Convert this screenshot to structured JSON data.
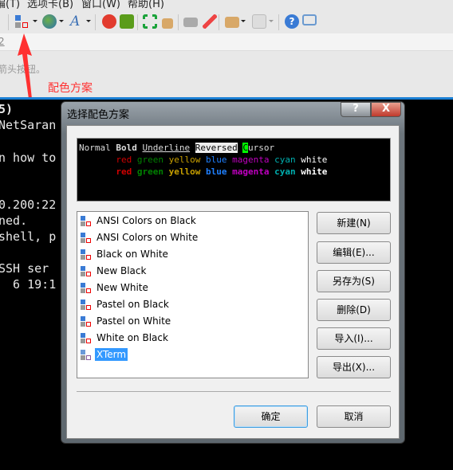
{
  "menubar": {
    "items": [
      "编(T)",
      "选项卡(B)",
      "窗口(W)",
      "帮助(H)"
    ]
  },
  "toolbar": {
    "icons": [
      "color-scheme-icon",
      "globe-icon",
      "font-icon",
      "xftp-icon",
      "xmanager-icon",
      "fullscreen-icon",
      "lock-icon",
      "keyboard-icon",
      "highlighter-icon",
      "new-folder-icon",
      "layout-icon",
      "help-icon",
      "chat-icon"
    ]
  },
  "address": {
    "text": "2"
  },
  "hint": {
    "text": "箭头按钮。"
  },
  "annotation": {
    "text": "配色方案",
    "color": "#ff3030"
  },
  "terminal": {
    "lines": [
      "5)",
      "NetSaran",
      "",
      "n how to",
      "",
      "",
      "0.200:22",
      "ned.",
      "shell, p",
      "",
      "SSH ser",
      "  6 19:1"
    ]
  },
  "dialog": {
    "title": "选择配色方案",
    "help_label": "?",
    "close_label": "X",
    "preview": {
      "row1": {
        "normal": "Normal",
        "bold": "Bold",
        "underline": "Underline",
        "reversed": "Reversed",
        "cursor_char": "C",
        "cursor_rest": "ursor"
      },
      "colors": [
        {
          "name": "red",
          "color": "#d00000"
        },
        {
          "name": "green",
          "color": "#008000"
        },
        {
          "name": "yellow",
          "color": "#c8a000"
        },
        {
          "name": "blue",
          "color": "#2080ff"
        },
        {
          "name": "magenta",
          "color": "#c000c0"
        },
        {
          "name": "cyan",
          "color": "#00b0b0"
        },
        {
          "name": "white",
          "color": "#ffffff"
        }
      ]
    },
    "schemes": [
      "ANSI Colors on Black",
      "ANSI Colors on White",
      "Black on White",
      "New Black",
      "New White",
      "Pastel on Black",
      "Pastel on White",
      "White on Black",
      "XTerm"
    ],
    "selected": "XTerm",
    "buttons": {
      "new": "新建(N)",
      "edit": "编辑(E)...",
      "save_as": "另存为(S)",
      "delete": "删除(D)",
      "import": "导入(I)...",
      "export": "导出(X)...",
      "ok": "确定",
      "cancel": "取消"
    }
  }
}
